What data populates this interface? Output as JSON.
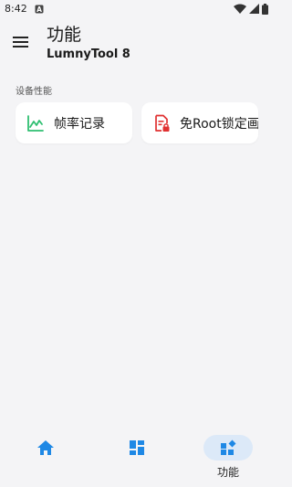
{
  "status_bar": {
    "time": "8:42",
    "notification_icon": "a-box-icon",
    "icons": [
      "wifi-icon",
      "signal-icon",
      "battery-icon"
    ]
  },
  "app_bar": {
    "title": "功能",
    "subtitle": "LumnyTool 8",
    "menu_icon": "hamburger-menu-icon"
  },
  "section": {
    "label": "设备性能",
    "cards": [
      {
        "label": "帧率记录",
        "icon": "line-chart-icon",
        "icon_color": "#2fbf71"
      },
      {
        "label": "免Root锁定画",
        "icon": "file-lock-icon",
        "icon_color": "#e03131"
      }
    ]
  },
  "bottom_nav": {
    "items": [
      {
        "id": "home",
        "icon": "home-icon",
        "label": ""
      },
      {
        "id": "dashboard",
        "icon": "grid-icon",
        "label": ""
      },
      {
        "id": "functions",
        "icon": "widgets-icon",
        "label": "功能",
        "selected": true
      }
    ],
    "accent": "#1e88e5",
    "selected_bg": "#dce9f8"
  }
}
